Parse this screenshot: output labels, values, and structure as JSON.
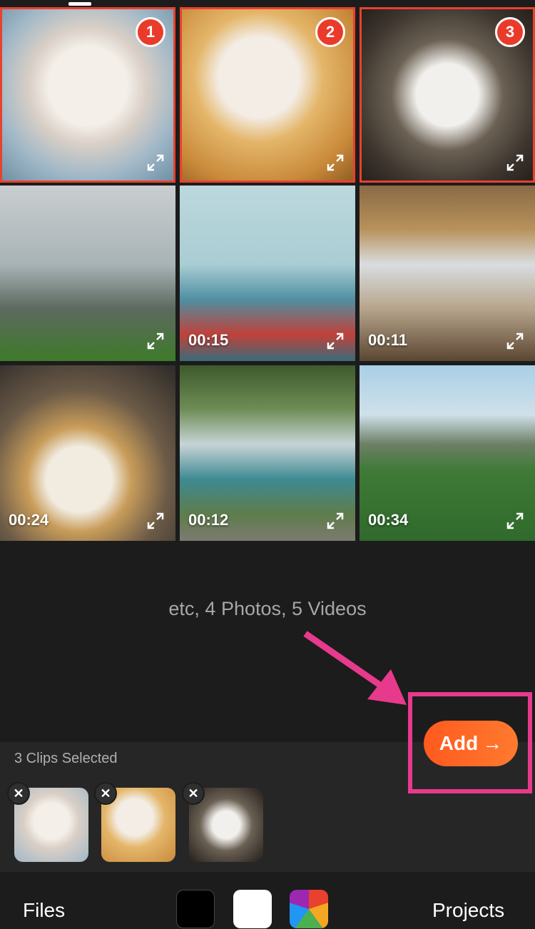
{
  "grid": {
    "tiles": [
      {
        "badge": "1",
        "duration": ""
      },
      {
        "badge": "2",
        "duration": ""
      },
      {
        "badge": "3",
        "duration": ""
      },
      {
        "badge": "",
        "duration": ""
      },
      {
        "badge": "",
        "duration": "00:15"
      },
      {
        "badge": "",
        "duration": "00:11"
      },
      {
        "badge": "",
        "duration": "00:24"
      },
      {
        "badge": "",
        "duration": "00:12"
      },
      {
        "badge": "",
        "duration": "00:34"
      }
    ]
  },
  "summary": "etc, 4 Photos, 5 Videos",
  "tray": {
    "label": "3 Clips Selected",
    "remove_glyph": "✕"
  },
  "add_button": {
    "label": "Add",
    "arrow": "→"
  },
  "bottom_bar": {
    "files_label": "Files",
    "projects_label": "Projects"
  },
  "colors": {
    "accent": "#ff5a1f",
    "selection": "#e8412d",
    "annotation": "#e83a8c"
  }
}
